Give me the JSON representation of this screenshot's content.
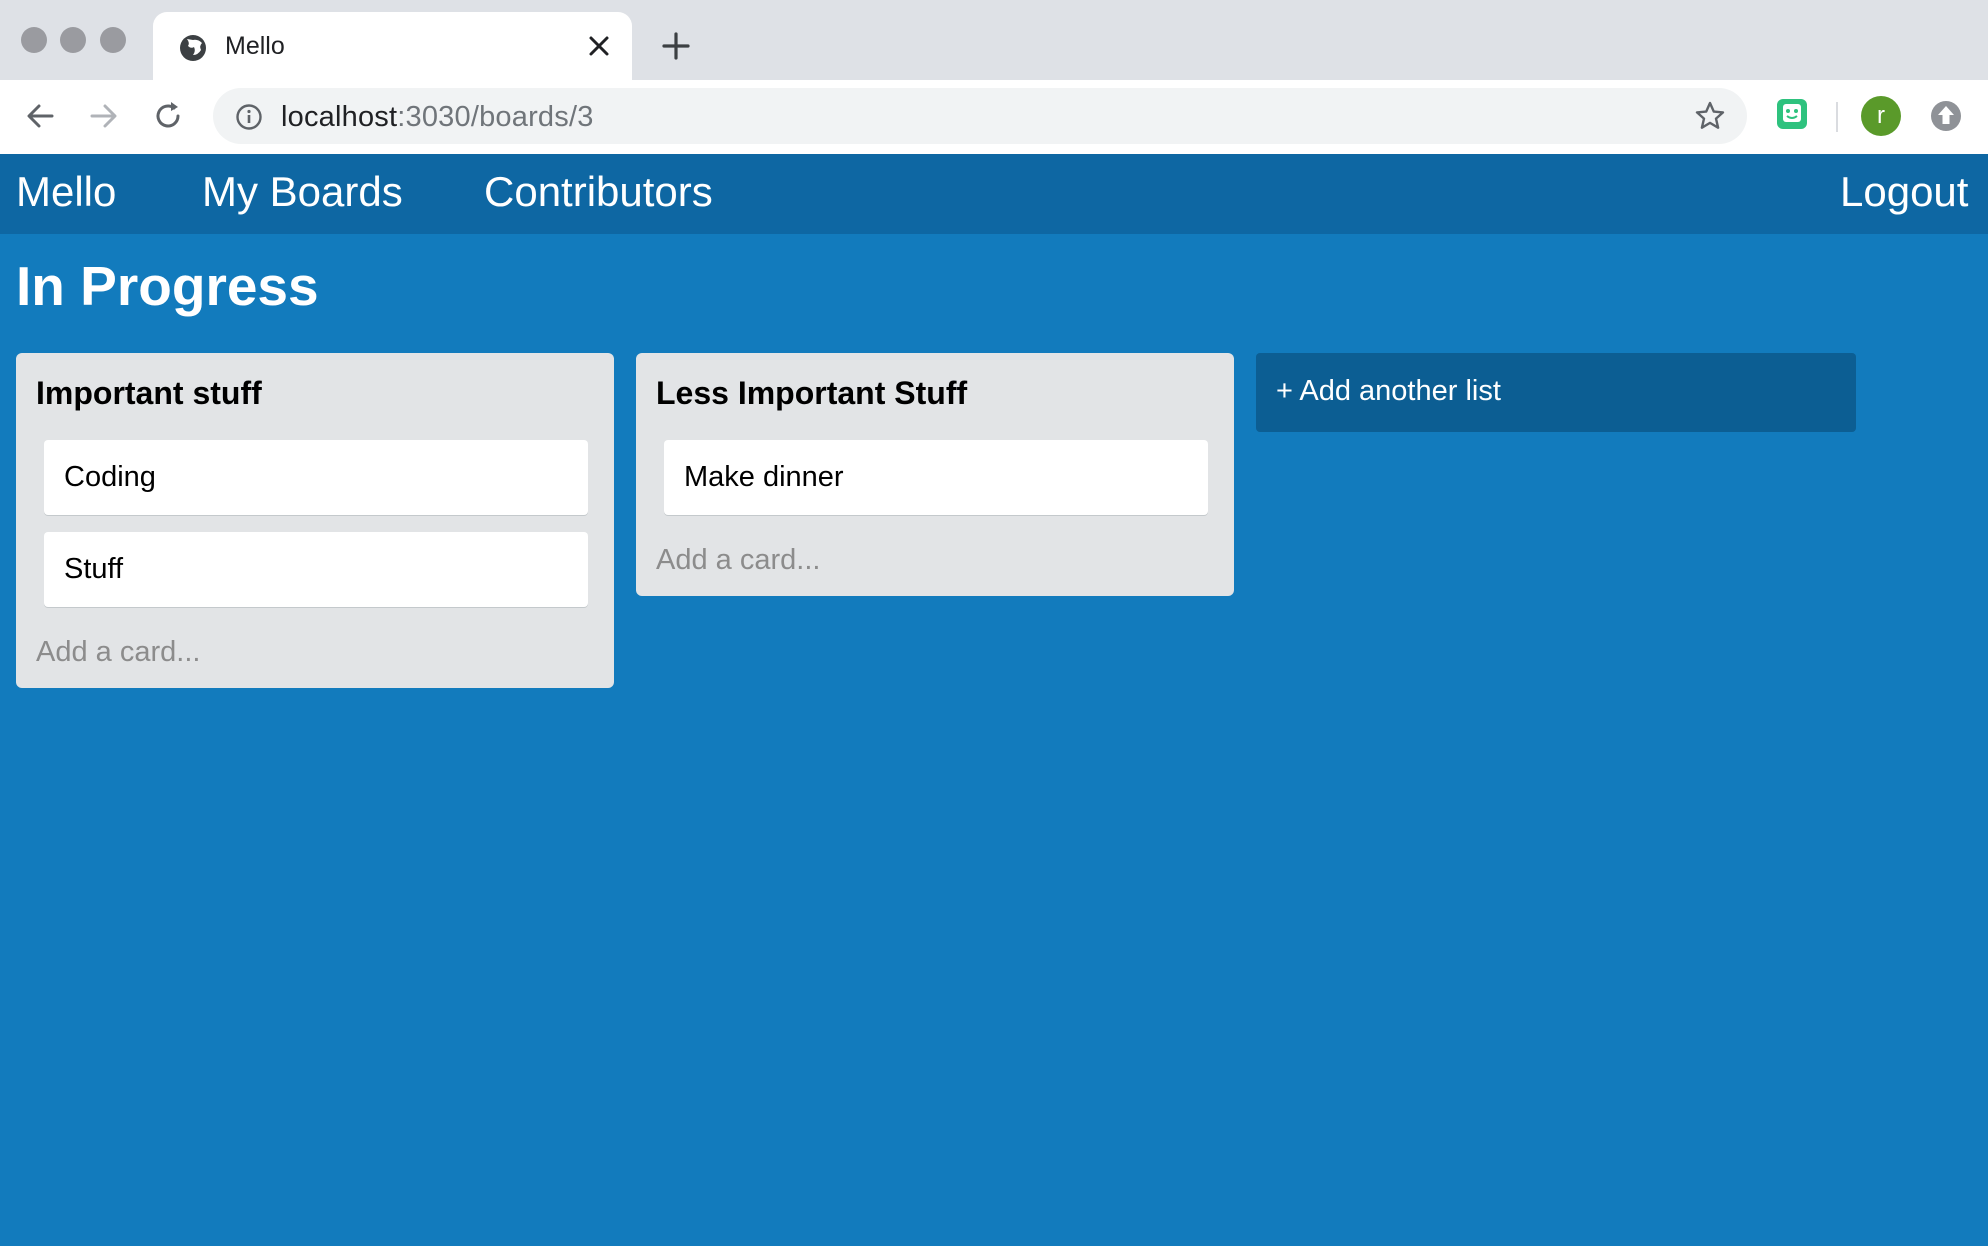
{
  "browser": {
    "tab_title": "Mello",
    "url_host": "localhost",
    "url_rest": ":3030/boards/3",
    "avatar_letter": "r"
  },
  "nav": {
    "brand": "Mello",
    "my_boards": "My Boards",
    "contributors": "Contributors",
    "logout": "Logout"
  },
  "board": {
    "title": "In Progress",
    "lists": [
      {
        "title": "Important stuff",
        "cards": [
          "Coding",
          "Stuff"
        ],
        "add_card": "Add a card..."
      },
      {
        "title": "Less Important Stuff",
        "cards": [
          "Make dinner"
        ],
        "add_card": "Add a card..."
      }
    ],
    "add_list": "+ Add another list"
  },
  "colors": {
    "board_bg": "#127bbd",
    "appbar_bg": "#0e67a3",
    "add_list_bg": "#0c5e93",
    "list_bg": "#e2e4e6"
  }
}
